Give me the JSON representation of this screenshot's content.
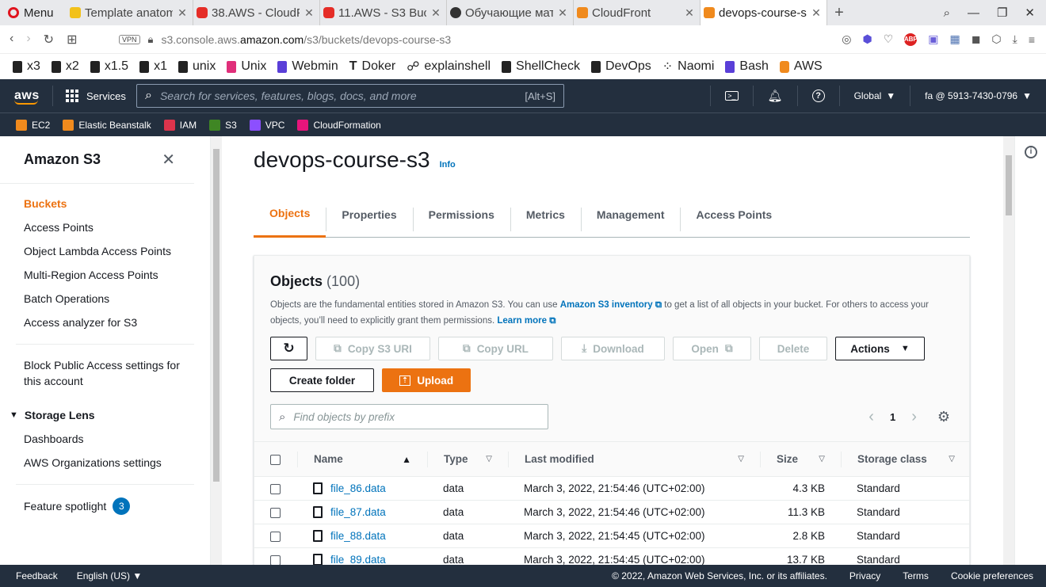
{
  "browser": {
    "menu_label": "Menu",
    "tabs": [
      {
        "title": "Template anatom",
        "favicon": "yellow"
      },
      {
        "title": "38.AWS - CloudF",
        "favicon": "youtube"
      },
      {
        "title": "11.AWS - S3 Buc",
        "favicon": "youtube"
      },
      {
        "title": "Обучающие мат",
        "favicon": "github"
      },
      {
        "title": "CloudFront",
        "favicon": "aws-orange"
      },
      {
        "title": "devops-course-s3",
        "favicon": "aws-orange",
        "active": true
      }
    ],
    "url_host": "s3.console.aws.amazon.com",
    "url_path": "/s3/buckets/devops-course-s3",
    "url_prefix": "s3.console.aws.",
    "url_domain": "amazon.com",
    "vpn_label": "VPN",
    "abp_label": "ABP"
  },
  "bookmarks": [
    {
      "label": "x3",
      "icon": "doc"
    },
    {
      "label": "x2",
      "icon": "doc"
    },
    {
      "label": "x1.5",
      "icon": "doc"
    },
    {
      "label": "x1",
      "icon": "doc"
    },
    {
      "label": "unix",
      "icon": "doc"
    },
    {
      "label": "Unix",
      "icon": "pink"
    },
    {
      "label": "Webmin",
      "icon": "purple"
    },
    {
      "label": "Doker",
      "icon": "doc"
    },
    {
      "label": "explainshell",
      "icon": "doc"
    },
    {
      "label": "ShellCheck",
      "icon": "doc"
    },
    {
      "label": "DevOps",
      "icon": "doc"
    },
    {
      "label": "Naomi",
      "icon": "doc"
    },
    {
      "label": "Bash",
      "icon": "purple"
    },
    {
      "label": "AWS",
      "icon": "orange"
    }
  ],
  "aws_nav": {
    "logo_text": "aws",
    "services_label": "Services",
    "search_placeholder": "Search for services, features, blogs, docs, and more",
    "search_shortcut": "[Alt+S]",
    "region": "Global",
    "account": "fa @ 5913-7430-0796"
  },
  "favorites": [
    {
      "label": "EC2",
      "color": "#f08a1d"
    },
    {
      "label": "Elastic Beanstalk",
      "color": "#f08a1d"
    },
    {
      "label": "IAM",
      "color": "#dd344c"
    },
    {
      "label": "S3",
      "color": "#3f8624"
    },
    {
      "label": "VPC",
      "color": "#8c4fff"
    },
    {
      "label": "CloudFormation",
      "color": "#e7157b"
    }
  ],
  "sidebar": {
    "title": "Amazon S3",
    "items": [
      {
        "label": "Buckets",
        "active": true
      },
      {
        "label": "Access Points"
      },
      {
        "label": "Object Lambda Access Points"
      },
      {
        "label": "Multi-Region Access Points"
      },
      {
        "label": "Batch Operations"
      },
      {
        "label": "Access analyzer for S3"
      }
    ],
    "block_public": "Block Public Access settings for this account",
    "storage_lens": "Storage Lens",
    "storage_items": [
      {
        "label": "Dashboards"
      },
      {
        "label": "AWS Organizations settings"
      }
    ],
    "feature_spotlight": "Feature spotlight",
    "feature_count": "3"
  },
  "main": {
    "bucket_name": "devops-course-s3",
    "info_label": "Info",
    "tabs": [
      {
        "label": "Objects",
        "active": true
      },
      {
        "label": "Properties"
      },
      {
        "label": "Permissions"
      },
      {
        "label": "Metrics"
      },
      {
        "label": "Management"
      },
      {
        "label": "Access Points"
      }
    ],
    "objects_title": "Objects",
    "objects_count": "(100)",
    "desc_part1": "Objects are the fundamental entities stored in Amazon S3. You can use ",
    "desc_link1": "Amazon S3 inventory",
    "desc_part2": " to get a list of all objects in your bucket. For others to access your objects, you’ll need to explicitly grant them permissions. ",
    "desc_link2": "Learn more",
    "buttons": {
      "copy_uri": "Copy S3 URI",
      "copy_url": "Copy URL",
      "download": "Download",
      "open": "Open",
      "delete": "Delete",
      "actions": "Actions",
      "create_folder": "Create folder",
      "upload": "Upload"
    },
    "filter_placeholder": "Find objects by prefix",
    "page_number": "1",
    "columns": {
      "name": "Name",
      "type": "Type",
      "last_modified": "Last modified",
      "size": "Size",
      "storage_class": "Storage class"
    },
    "rows": [
      {
        "name": "file_86.data",
        "type": "data",
        "modified": "March 3, 2022, 21:54:46 (UTC+02:00)",
        "size": "4.3 KB",
        "storage": "Standard"
      },
      {
        "name": "file_87.data",
        "type": "data",
        "modified": "March 3, 2022, 21:54:46 (UTC+02:00)",
        "size": "11.3 KB",
        "storage": "Standard"
      },
      {
        "name": "file_88.data",
        "type": "data",
        "modified": "March 3, 2022, 21:54:45 (UTC+02:00)",
        "size": "2.8 KB",
        "storage": "Standard"
      },
      {
        "name": "file_89.data",
        "type": "data",
        "modified": "March 3, 2022, 21:54:45 (UTC+02:00)",
        "size": "13.7 KB",
        "storage": "Standard"
      }
    ]
  },
  "footer": {
    "feedback": "Feedback",
    "language": "English (US)",
    "copyright": "© 2022, Amazon Web Services, Inc. or its affiliates.",
    "privacy": "Privacy",
    "terms": "Terms",
    "cookies": "Cookie preferences"
  },
  "colors": {
    "aws_nav": "#232f3e",
    "accent_orange": "#ec7211",
    "link_blue": "#0073bb"
  }
}
